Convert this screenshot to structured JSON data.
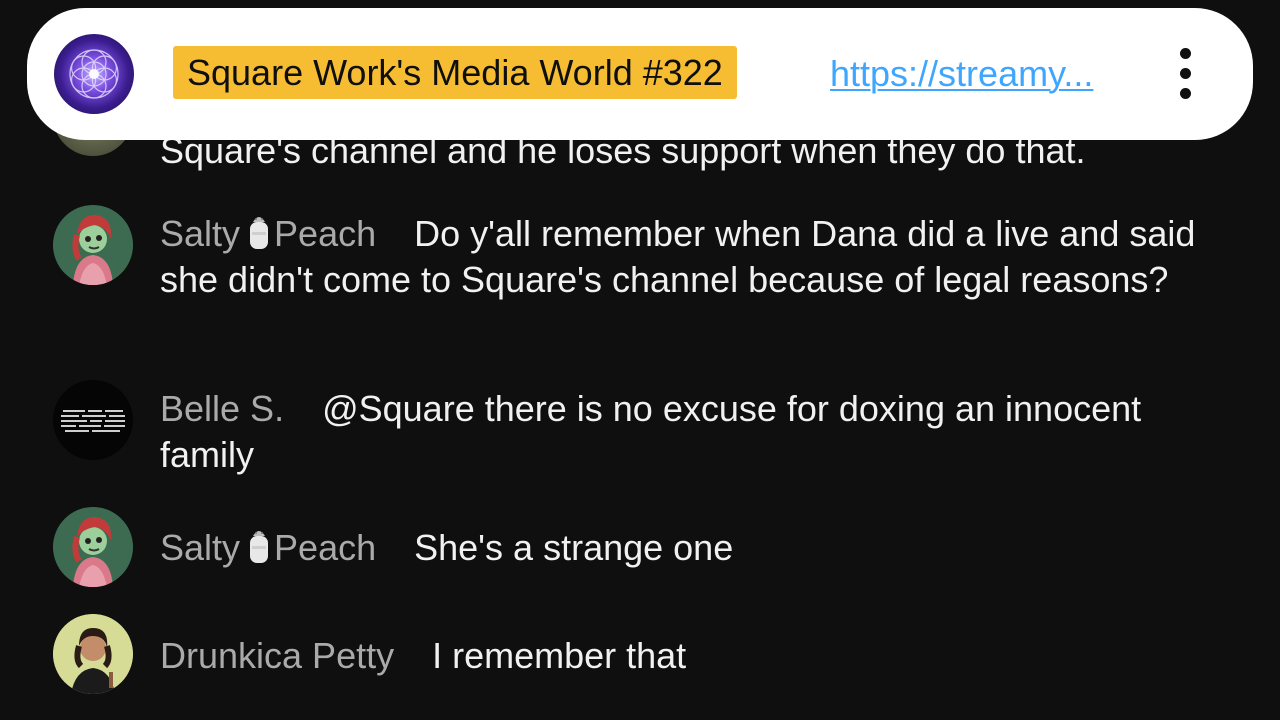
{
  "banner": {
    "title": "Square Work's Media World #322",
    "link": "https://streamy...",
    "avatar_icon": "sacred-geometry-logo",
    "menu_icon": "more-vertical-icon",
    "title_bg": "#f6bd33",
    "link_color": "#3ea6ff"
  },
  "chat": {
    "partial_message": {
      "text": "Square's channel and he loses support when they do that."
    },
    "messages": [
      {
        "author": "Salty",
        "author_suffix": "Peach",
        "author_emoji": "salt-shaker-icon",
        "text": "Do y'all remember when Dana did a live and said she didn't come to Square's channel because of legal reasons?"
      },
      {
        "author": "Belle S.",
        "text": "@Square there is no excuse for doxing an innocent family"
      },
      {
        "author": "Salty",
        "author_suffix": "Peach",
        "author_emoji": "salt-shaker-icon",
        "text": "She's a strange one"
      },
      {
        "author": "Drunkica Petty",
        "text": "I remember that"
      }
    ],
    "colors": {
      "background": "#0f0f0f",
      "author": "#aaaaaa",
      "text": "#f1f1f1"
    }
  }
}
